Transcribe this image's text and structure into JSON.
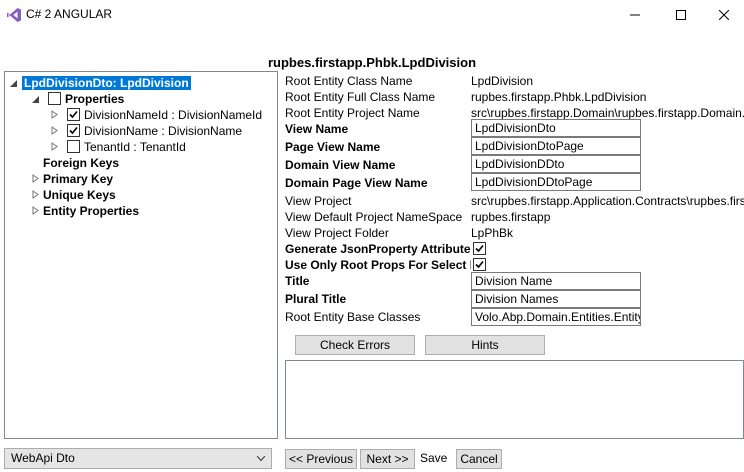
{
  "window": {
    "title": "C# 2 ANGULAR"
  },
  "heading": "rupbes.firstapp.Phbk.LpdDivision",
  "tree": {
    "root": "LpdDivisionDto: LpdDivision",
    "properties_label": "Properties",
    "properties": [
      {
        "label": "DivisionNameId : DivisionNameId",
        "checked": true
      },
      {
        "label": "DivisionName : DivisionName",
        "checked": true
      },
      {
        "label": "TenantId : TenantId",
        "checked": false
      }
    ],
    "sections": [
      "Foreign Keys",
      "Primary Key",
      "Unique Keys",
      "Entity Properties"
    ]
  },
  "props": {
    "root_entity_class_name": {
      "label": "Root Entity Class Name",
      "value": "LpdDivision"
    },
    "root_entity_full_class_name": {
      "label": "Root Entity Full Class Name",
      "value": "rupbes.firstapp.Phbk.LpdDivision"
    },
    "root_entity_project_name": {
      "label": "Root Entity Project Name",
      "value": "src\\rupbes.firstapp.Domain\\rupbes.firstapp.Domain."
    },
    "view_name": {
      "label": "View Name",
      "value": "LpdDivisionDto"
    },
    "page_view_name": {
      "label": "Page View Name",
      "value": "LpdDivisionDtoPage"
    },
    "domain_view_name": {
      "label": "Domain View Name",
      "value": "LpdDivisionDDto"
    },
    "domain_page_view_name": {
      "label": "Domain Page View Name",
      "value": "LpdDivisionDDtoPage"
    },
    "view_project": {
      "label": "View Project",
      "value": "src\\rupbes.firstapp.Application.Contracts\\rupbes.firs"
    },
    "view_default_ns": {
      "label": "View Default Project NameSpace",
      "value": "rupbes.firstapp"
    },
    "view_project_folder": {
      "label": "View Project Folder",
      "value": "LpPhBk"
    },
    "gen_json_attr": {
      "label": "Generate JsonProperty Attribute",
      "checked": true
    },
    "use_only_root_props": {
      "label": "Use Only Root Props For Select M",
      "checked": true
    },
    "title": {
      "label": "Title",
      "value": "Division Name"
    },
    "plural_title": {
      "label": "Plural Title",
      "value": "Division Names"
    },
    "root_entity_base_classes": {
      "label": "Root Entity Base Classes",
      "value": "Volo.Abp.Domain.Entities.Entity"
    }
  },
  "buttons": {
    "check_errors": "Check Errors",
    "hints": "Hints",
    "previous": "<< Previous",
    "next": "Next >>",
    "save": "Save",
    "cancel": "Cancel"
  },
  "combo": {
    "selected": "WebApi Dto"
  },
  "colors": {
    "selection": "#0078d7",
    "vs_purple": "#865fc5"
  }
}
